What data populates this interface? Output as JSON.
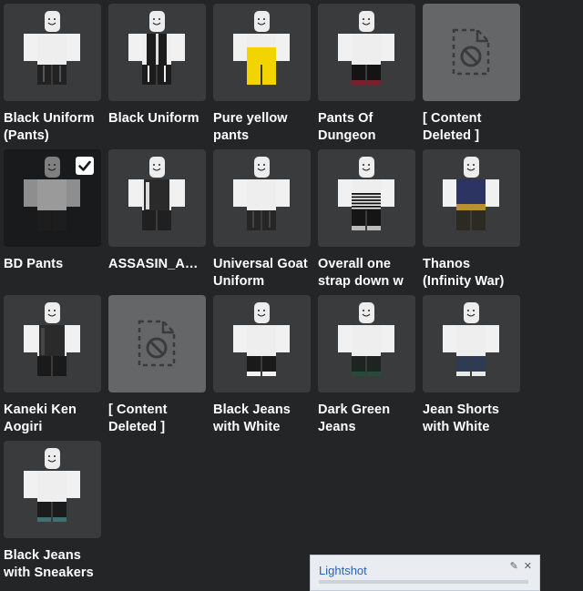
{
  "colors": {
    "background": "#232527",
    "tile": "#393b3d",
    "tile_selected": "#191a1c",
    "tile_deleted": "#656668",
    "text": "#ffffff"
  },
  "items": [
    {
      "name": "Black Uniform (Pants)",
      "pants": "black-uniform"
    },
    {
      "name": "Black Uniform",
      "pants": "black-uniform-2"
    },
    {
      "name": "Pure yellow pants",
      "pants": "yellow"
    },
    {
      "name": "Pants Of Dungeon",
      "pants": "dungeon"
    },
    {
      "name": "[ Content Deleted ]",
      "deleted": true
    },
    {
      "name": "BD Pants",
      "pants": "bd",
      "selected": true
    },
    {
      "name": "ASSASIN_ASSASIN",
      "pants": "assassin",
      "oneline": true
    },
    {
      "name": "Universal Goat Uniform",
      "pants": "goat"
    },
    {
      "name": "Overall one strap down w",
      "pants": "overall"
    },
    {
      "name": "Thanos (Infinity War)",
      "pants": "thanos"
    },
    {
      "name": "Kaneki Ken Aogiri",
      "pants": "kaneki"
    },
    {
      "name": "[ Content Deleted ]",
      "deleted": true
    },
    {
      "name": "Black Jeans with White",
      "pants": "black-jeans-white"
    },
    {
      "name": "Dark Green Jeans",
      "pants": "dark-green"
    },
    {
      "name": "Jean Shorts with White",
      "pants": "jean-shorts"
    },
    {
      "name": "Black Jeans with Sneakers",
      "pants": "black-jeans-sneakers"
    }
  ],
  "lightshot": {
    "title": "Lightshot",
    "icons": [
      "settings-icon",
      "close-icon"
    ]
  }
}
